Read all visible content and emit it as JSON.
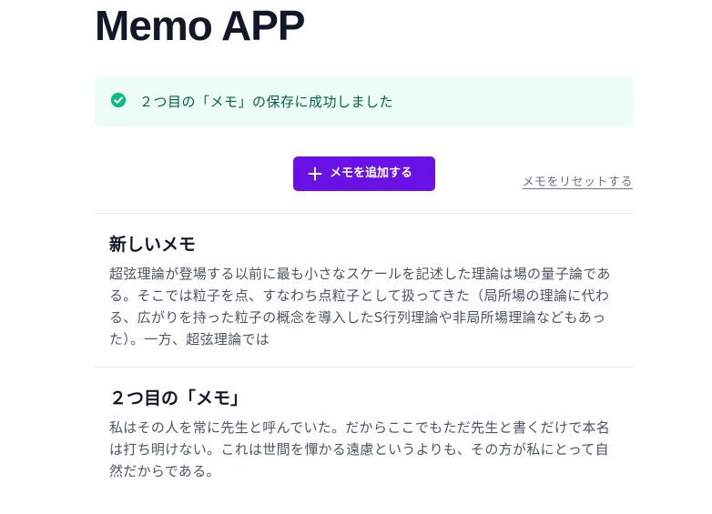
{
  "app": {
    "title": "Memo APP"
  },
  "alert": {
    "icon": "check-circle-icon",
    "message": "２つ目の「メモ」の保存に成功しました",
    "color": "#10b981"
  },
  "toolbar": {
    "add_label": "メモを追加する",
    "add_icon": "plus-icon",
    "reset_label": "メモをリセットする"
  },
  "memos": [
    {
      "title": "新しいメモ",
      "body": "超弦理論が登場する以前に最も小さなスケールを記述した理論は場の量子論である。そこでは粒子を点、すなわち点粒子として扱ってきた（局所場の理論に代わる、広がりを持った粒子の概念を導入したS行列理論や非局所場理論などもあった）。一方、超弦理論では"
    },
    {
      "title": "２つ目の「メモ」",
      "body": "私はその人を常に先生と呼んでいた。だからここでもただ先生と書くだけで本名は打ち明けない。これは世間を憚かる遠慮というよりも、その方が私にとって自然だからである。"
    }
  ],
  "colors": {
    "accent": "#6a11e6",
    "alert_bg": "#ecfdf5",
    "alert_text": "#065f46"
  }
}
